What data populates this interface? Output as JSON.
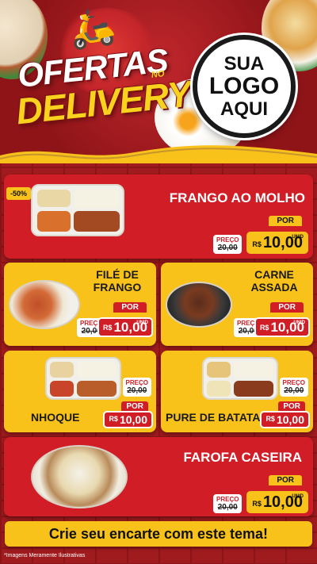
{
  "header": {
    "title_line1": "OFERTAS",
    "title_no": "NO",
    "title_line2": "DELIVERY",
    "logo": [
      "SUA",
      "LOGO",
      "AQUI"
    ]
  },
  "badge": "-50%",
  "labels": {
    "preco": "PREÇO",
    "por": "POR",
    "currency": "R$",
    "unit": "UNID"
  },
  "products": [
    {
      "name": "FRANGO AO MOLHO",
      "old_price": "20,00",
      "price": "10,00"
    },
    {
      "name": "FILÉ DE FRANGO",
      "old_price": "20,00",
      "price": "10,00"
    },
    {
      "name": "CARNE ASSADA",
      "old_price": "20,00",
      "price": "10,00"
    },
    {
      "name": "NHOQUE",
      "old_price": "20,00",
      "price": "10,00"
    },
    {
      "name": "PURE DE BATATA",
      "old_price": "20,00",
      "price": "10,00"
    },
    {
      "name": "FAROFA CASEIRA",
      "old_price": "20,00",
      "price": "10,00"
    }
  ],
  "banner": "Crie seu encarte com este tema!",
  "footnote": "*Imagens Meramente Ilustrativas",
  "colors": {
    "red": "#d01d26",
    "yellow": "#f8c21a",
    "dark_red": "#8f1418"
  }
}
